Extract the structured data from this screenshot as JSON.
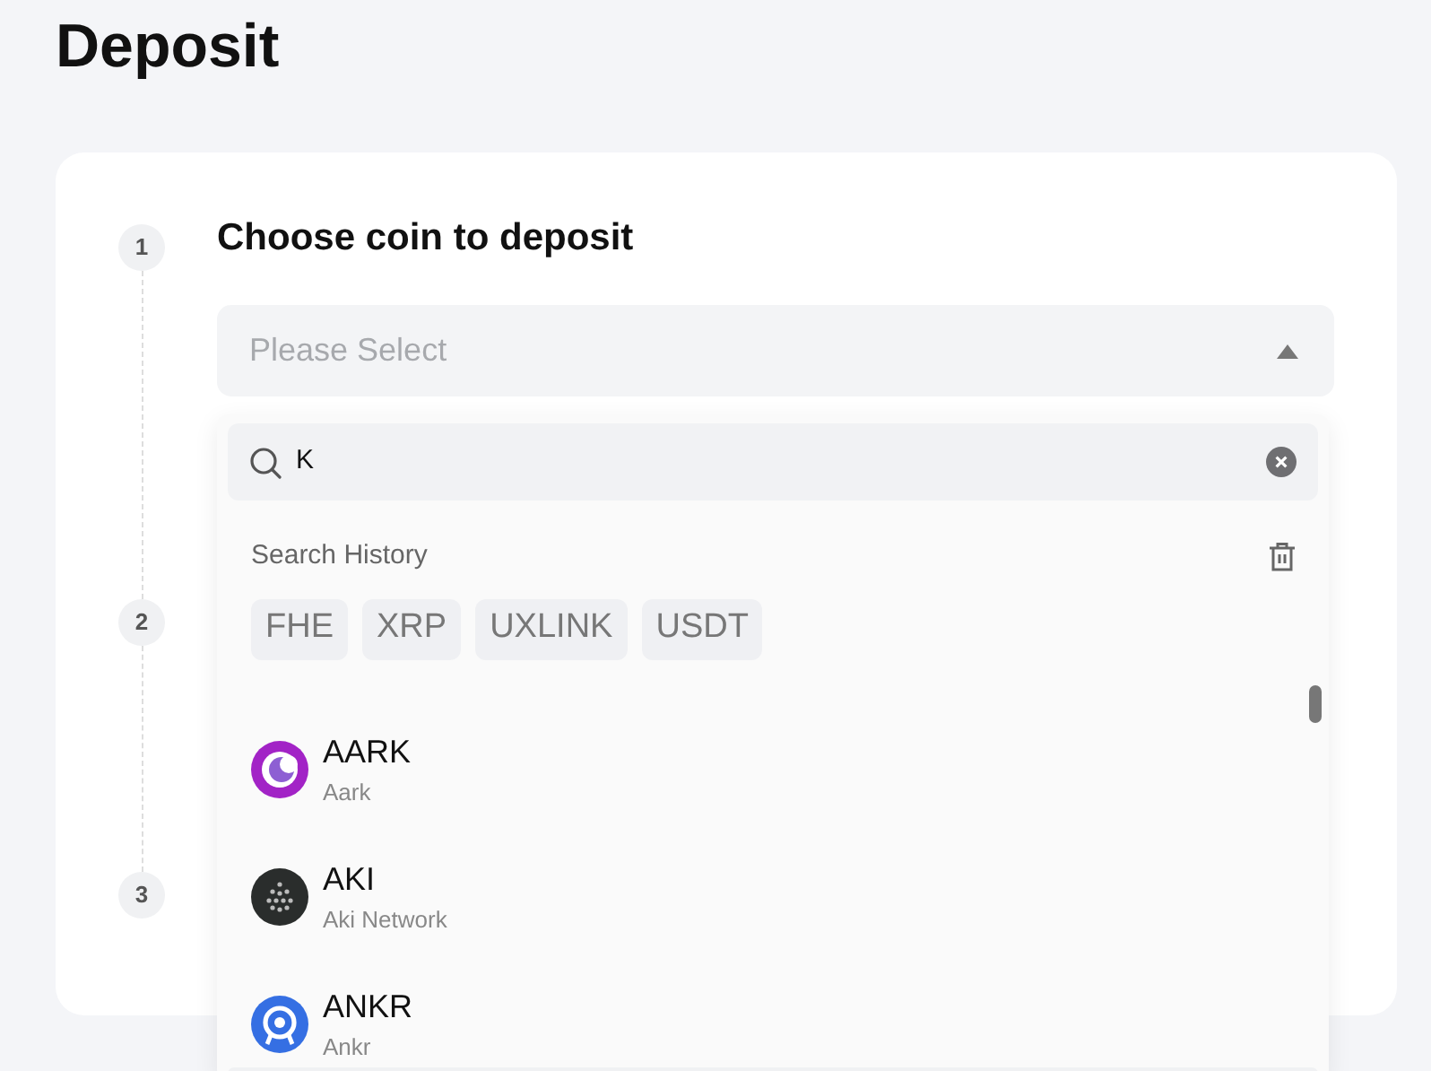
{
  "page": {
    "title": "Deposit"
  },
  "steps": [
    {
      "number": "1",
      "title": "Choose coin to deposit"
    },
    {
      "number": "2"
    },
    {
      "number": "3"
    }
  ],
  "coin_select": {
    "placeholder": "Please Select",
    "expanded": true
  },
  "dropdown": {
    "search": {
      "value": "K"
    },
    "history_label": "Search History",
    "history": [
      "FHE",
      "XRP",
      "UXLINK",
      "USDT"
    ],
    "coins": [
      {
        "symbol": "AARK",
        "name": "Aark",
        "kind": "ring"
      },
      {
        "symbol": "AKI",
        "name": "Aki Network",
        "kind": "dots"
      },
      {
        "symbol": "ANKR",
        "name": "Ankr",
        "kind": "eye"
      }
    ]
  }
}
